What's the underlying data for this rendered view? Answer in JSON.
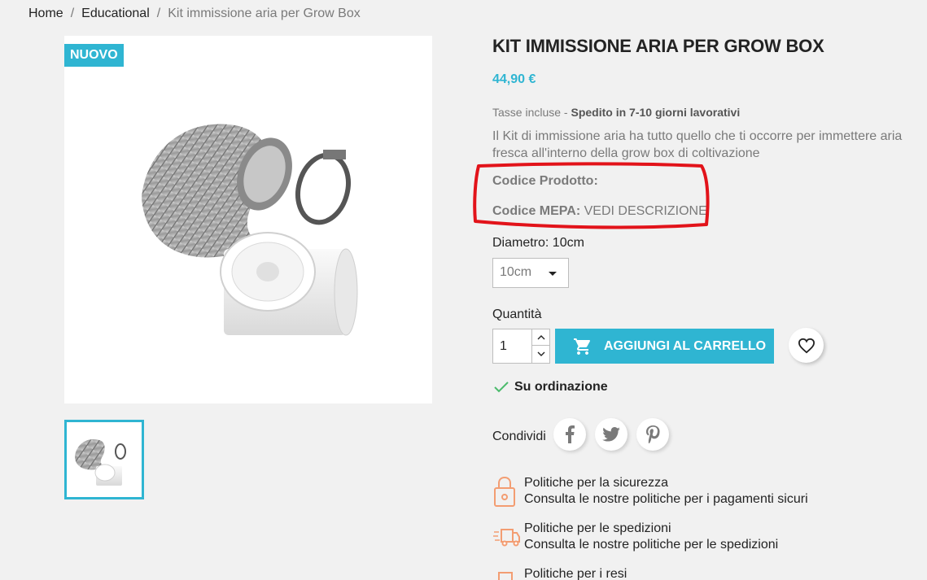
{
  "breadcrumb": {
    "home": "Home",
    "category": "Educational",
    "current": "Kit immissione aria per Grow Box",
    "sep": "/"
  },
  "badge": "Nuovo",
  "product": {
    "title": "Kit immissione aria per Grow Box",
    "price": "44,90 €",
    "tax": "Tasse incluse",
    "tax_sep": " - ",
    "shipping": "Spedito in 7-10 giorni lavorativi",
    "description": "Il Kit di immissione aria ha tutto quello che ti occorre per immettere aria fresca all'interno della grow box di coltivazione",
    "code_label": "Codice Prodotto:",
    "mepa_label": "Codice MEPA:",
    "mepa_value": "VEDI DESCRIZIONE"
  },
  "variant": {
    "label": "Diametro: 10cm",
    "selected": "10cm"
  },
  "quantity": {
    "label": "Quantità",
    "value": "1"
  },
  "cart": {
    "add_label": "Aggiungi al carrello"
  },
  "stock": {
    "label": "Su ordinazione"
  },
  "share": {
    "label": "Condividi"
  },
  "policies": [
    {
      "title": "Politiche per la sicurezza",
      "text": "Consulta le nostre politiche per i pagamenti sicuri"
    },
    {
      "title": "Politiche per le spedizioni",
      "text": "Consulta le nostre politiche per le spedizioni"
    },
    {
      "title": "Politiche per i resi",
      "text": ""
    }
  ],
  "colors": {
    "accent": "#2fb5d2",
    "annotation": "#e2131a",
    "check": "#4cbb6c"
  }
}
